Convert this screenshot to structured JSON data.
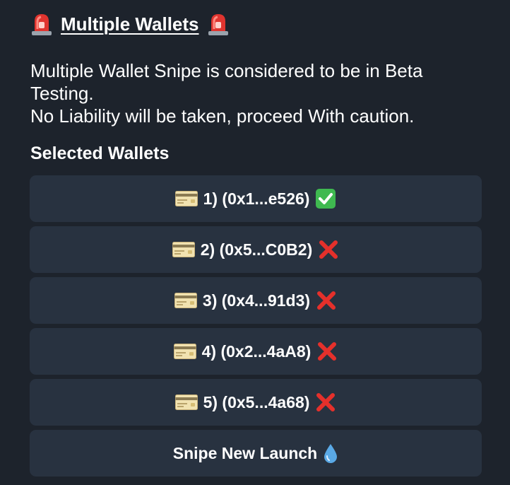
{
  "header": {
    "title": "Multiple Wallets",
    "left_icon": "rotating-light-icon",
    "right_icon": "rotating-light-icon"
  },
  "body": {
    "line1": "Multiple Wallet Snipe is considered to be in Beta Testing.",
    "line2": "No Liability will be taken, proceed With caution."
  },
  "section": {
    "label": "Selected Wallets"
  },
  "wallets": [
    {
      "label": "1) (0x1...e526)",
      "icon": "credit-card-icon",
      "status": "check",
      "status_icon": "check-mark-icon"
    },
    {
      "label": "2) (0x5...C0B2)",
      "icon": "credit-card-icon",
      "status": "cross",
      "status_icon": "cross-mark-icon"
    },
    {
      "label": "3) (0x4...91d3)",
      "icon": "credit-card-icon",
      "status": "cross",
      "status_icon": "cross-mark-icon"
    },
    {
      "label": "4) (0x2...4aA8)",
      "icon": "credit-card-icon",
      "status": "cross",
      "status_icon": "cross-mark-icon"
    },
    {
      "label": "5) (0x5...4a68)",
      "icon": "credit-card-icon",
      "status": "cross",
      "status_icon": "cross-mark-icon"
    }
  ],
  "action": {
    "label": "Snipe New Launch",
    "icon": "droplet-icon"
  },
  "colors": {
    "background": "#1d232c",
    "button": "#283240",
    "text": "#ffffff",
    "check": "#3fb950",
    "cross": "#e5302b",
    "droplet": "#5aa9e6"
  }
}
